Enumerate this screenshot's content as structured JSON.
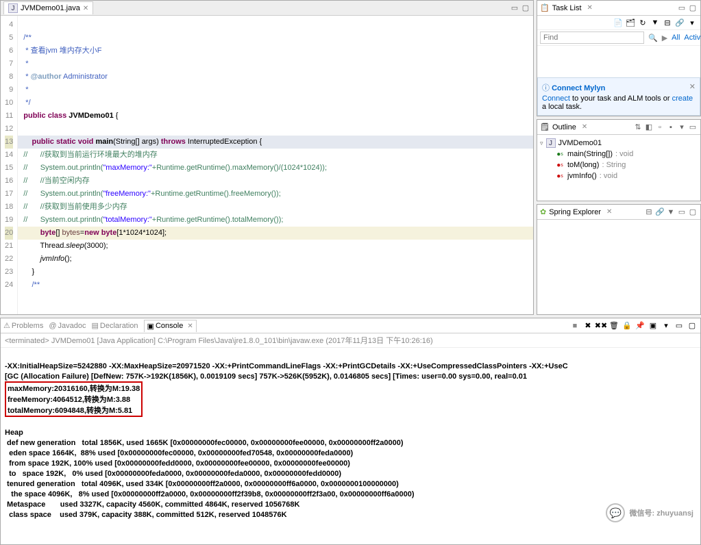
{
  "editor": {
    "file_tab": "JVMDemo01.java",
    "lines": [
      {
        "n": 4,
        "cls": "",
        "html": ""
      },
      {
        "n": 5,
        "cls": "",
        "html": "<span class=\"doc\">/**</span>"
      },
      {
        "n": 6,
        "cls": "",
        "html": "<span class=\"doc\"> * 查看jvm 堆内存大小F</span>"
      },
      {
        "n": 7,
        "cls": "",
        "html": "<span class=\"doc\"> *</span>"
      },
      {
        "n": 8,
        "cls": "",
        "html": "<span class=\"doc\"> * <span class=\"doctag\">@author</span> Administrator</span>"
      },
      {
        "n": 9,
        "cls": "",
        "html": "<span class=\"doc\"> *</span>"
      },
      {
        "n": 10,
        "cls": "",
        "html": "<span class=\"doc\"> */</span>"
      },
      {
        "n": 11,
        "cls": "",
        "html": "<span class=\"kw\">public</span> <span class=\"kw\">class</span> <span style=\"font-weight:bold\">JVMDemo01</span> {"
      },
      {
        "n": 12,
        "cls": "",
        "html": ""
      },
      {
        "n": 13,
        "cls": "hl-blue",
        "html": "    <span class=\"kw\">public</span> <span class=\"kw\">static</span> <span class=\"kw\">void</span> <span style=\"font-weight:bold\">main</span>(String[] args) <span class=\"kw\">throws</span> InterruptedException {"
      },
      {
        "n": 14,
        "cls": "",
        "html": "<span class=\"com\">//      //获取到当前运行环境最大的堆内存</span>"
      },
      {
        "n": 15,
        "cls": "",
        "html": "<span class=\"com\">//      System.out.println(<span class=\"str\">\"maxMemory:\"</span>+Runtime.getRuntime().maxMemory()/(1024*1024));</span>"
      },
      {
        "n": 16,
        "cls": "",
        "html": "<span class=\"com\">//      //当前空闲内存</span>"
      },
      {
        "n": 17,
        "cls": "",
        "html": "<span class=\"com\">//      System.out.println(<span class=\"str\">\"freeMemory:\"</span>+Runtime.getRuntime().freeMemory());</span>"
      },
      {
        "n": 18,
        "cls": "",
        "html": "<span class=\"com\">//      //获取到当前使用多少内存</span>"
      },
      {
        "n": 19,
        "cls": "",
        "html": "<span class=\"com\">//      System.out.println(<span class=\"str\">\"totalMemory:\"</span>+Runtime.getRuntime().totalMemory());</span>"
      },
      {
        "n": 20,
        "cls": "hl-yellow",
        "html": "        <span class=\"kw\">byte</span>[] <span style=\"color:#6a3e3e\">bytes</span>=<span class=\"kw\">new</span> <span class=\"kw\">byte</span>[1*1024*1024];"
      },
      {
        "n": 21,
        "cls": "",
        "html": "        Thread.<span style=\"font-style:italic\">sleep</span>(3000);"
      },
      {
        "n": 22,
        "cls": "",
        "html": "        <span style=\"font-style:italic\">jvmInfo</span>();"
      },
      {
        "n": 23,
        "cls": "",
        "html": "    }"
      },
      {
        "n": 24,
        "cls": "",
        "html": "    <span class=\"doc\">/**</span>"
      }
    ]
  },
  "tasklist": {
    "title": "Task List",
    "find_placeholder": "Find",
    "all": "All",
    "activate": "Activate..."
  },
  "mylyn": {
    "title": "Connect Mylyn",
    "text_before": "Connect",
    "text_mid": " to your task and ALM tools or ",
    "text_create": "create",
    "text_after": " a local task."
  },
  "outline": {
    "title": "Outline",
    "root": "JVMDemo01",
    "items": [
      {
        "icon": "pub",
        "label": "main(String[])",
        "sig": " : void"
      },
      {
        "icon": "red",
        "label": "toM(long)",
        "sig": " : String"
      },
      {
        "icon": "red",
        "label": "jvmInfo()",
        "sig": " : void"
      }
    ]
  },
  "spring": {
    "title": "Spring Explorer"
  },
  "bottom": {
    "tabs": [
      "Problems",
      "Javadoc",
      "Declaration",
      "Console"
    ],
    "active": 3,
    "launch": "<terminated> JVMDemo01 [Java Application] C:\\Program Files\\Java\\jre1.8.0_101\\bin\\javaw.exe (2017年11月13日 下午10:26:16)",
    "out1": "-XX:InitialHeapSize=5242880 -XX:MaxHeapSize=20971520 -XX:+PrintCommandLineFlags -XX:+PrintGCDetails -XX:+UseCompressedClassPointers -XX:+UseC",
    "out2": "[GC (Allocation Failure) [DefNew: 757K->192K(1856K), 0.0019109 secs] 757K->526K(5952K), 0.0146805 secs] [Times: user=0.00 sys=0.00, real=0.01",
    "mem1": "maxMemory:20316160,转换为M:19.38",
    "mem2": "freeMemory:4064512,转换为M:3.88",
    "mem3": "totalMemory:6094848,转换为M:5.81",
    "heap": [
      "Heap",
      " def new generation   total 1856K, used 1665K [0x00000000fec00000, 0x00000000fee00000, 0x00000000ff2a0000)",
      "  eden space 1664K,  88% used [0x00000000fec00000, 0x00000000fed70548, 0x00000000feda0000)",
      "  from space 192K, 100% used [0x00000000fedd0000, 0x00000000fee00000, 0x00000000fee00000)",
      "  to   space 192K,   0% used [0x00000000feda0000, 0x00000000feda0000, 0x00000000fedd0000)",
      " tenured generation   total 4096K, used 334K [0x00000000ff2a0000, 0x00000000ff6a0000, 0x0000000100000000)",
      "   the space 4096K,   8% used [0x00000000ff2a0000, 0x00000000ff2f39b8, 0x00000000ff2f3a00, 0x00000000ff6a0000)",
      " Metaspace       used 3327K, capacity 4560K, committed 4864K, reserved 1056768K",
      "  class space    used 379K, capacity 388K, committed 512K, reserved 1048576K"
    ]
  },
  "watermark": "微信号: zhuyuansj"
}
